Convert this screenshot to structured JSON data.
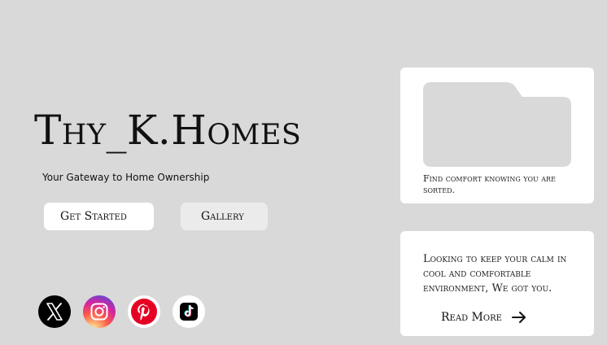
{
  "hero": {
    "title": "Thy_K.Homes",
    "tagline": "Your Gateway to Home Ownership",
    "get_started_label": "Get Started",
    "gallery_label": "Gallery"
  },
  "social": {
    "icons": [
      "x-icon",
      "instagram-icon",
      "pinterest-icon",
      "tiktok-icon"
    ]
  },
  "cards": {
    "top_text": "Find comfort knowing you are sorted.",
    "bottom_text": "Looking to keep your calm in cool and comfortable environment, We got you.",
    "read_more_label": "Read More"
  },
  "colors": {
    "background": "#d9d9d9",
    "card": "#ffffff",
    "folder": "#d9d9d9"
  }
}
